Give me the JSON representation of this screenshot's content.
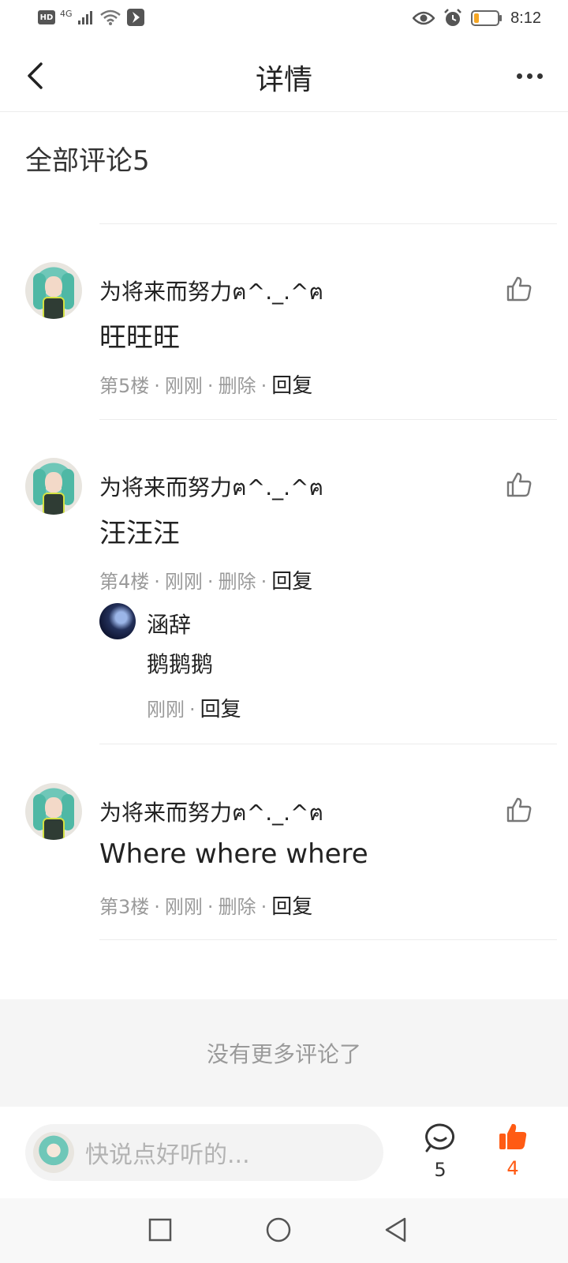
{
  "status_bar": {
    "hd": "HD",
    "network": "4G",
    "time": "8:12"
  },
  "header": {
    "title": "详情"
  },
  "section": {
    "title": "全部评论5"
  },
  "comments": [
    {
      "user": "为将来而努力ฅ^._.^ฅ",
      "content": "旺旺旺",
      "floor": "第5楼",
      "time": "刚刚",
      "delete": "删除",
      "reply": "回复"
    },
    {
      "user": "为将来而努力ฅ^._.^ฅ",
      "content": "汪汪汪",
      "floor": "第4楼",
      "time": "刚刚",
      "delete": "删除",
      "reply": "回复",
      "sub_reply": {
        "user": "涵辞",
        "content": "鹅鹅鹅",
        "time": "刚刚",
        "reply": "回复"
      }
    },
    {
      "user": "为将来而努力ฅ^._.^ฅ",
      "content": "Where where where",
      "floor": "第3楼",
      "time": "刚刚",
      "delete": "删除",
      "reply": "回复"
    }
  ],
  "footer": {
    "no_more": "没有更多评论了"
  },
  "bottom_bar": {
    "placeholder": "快说点好听的...",
    "comment_count": "5",
    "like_count": "4"
  },
  "colors": {
    "accent": "#ff5b14",
    "muted": "#9a9a9a"
  }
}
